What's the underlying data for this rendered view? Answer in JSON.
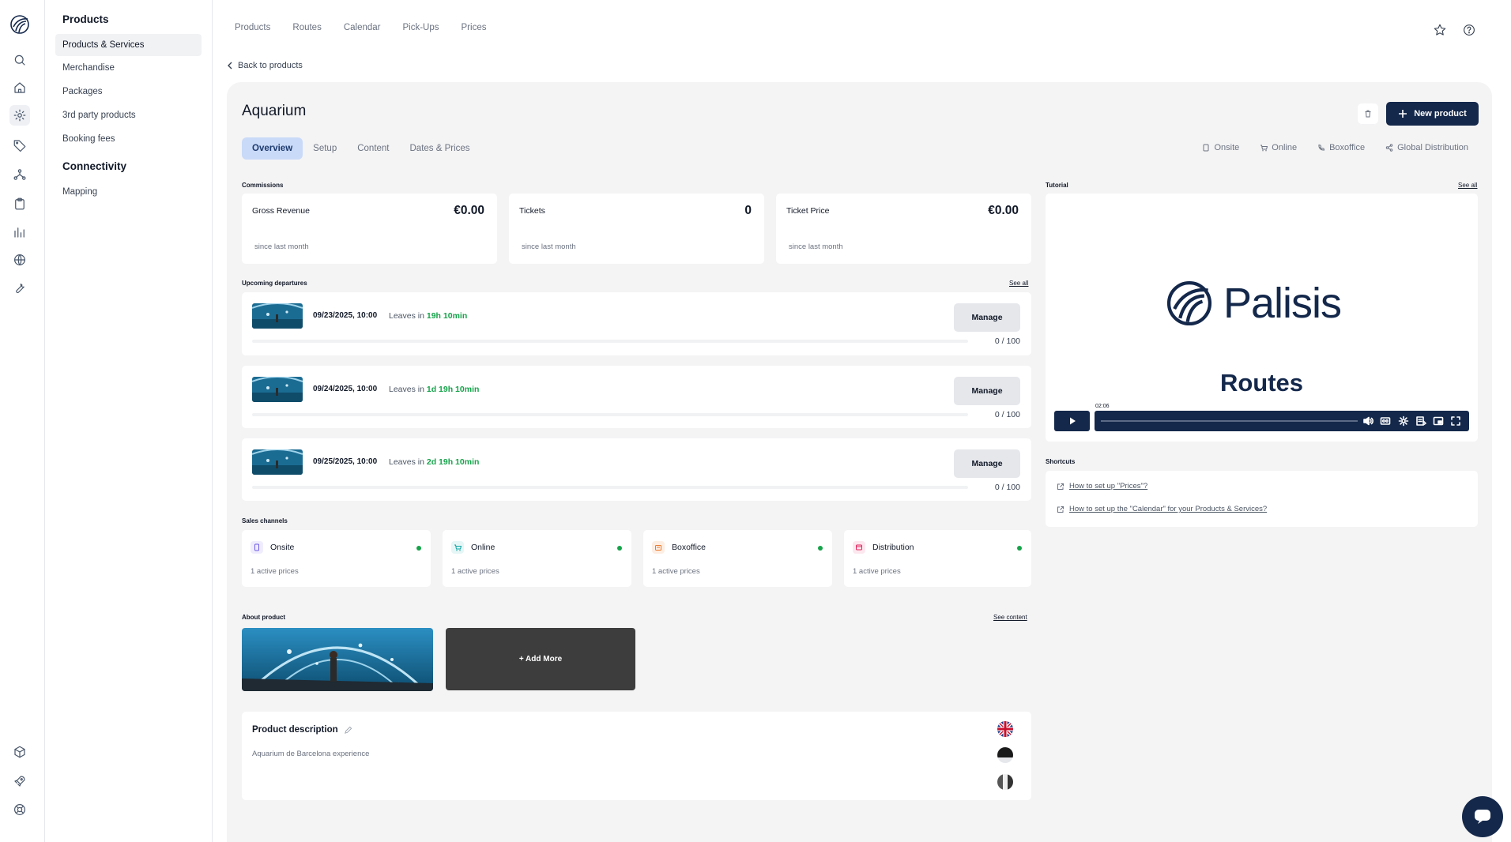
{
  "sidebar": {
    "group1_title": "Products",
    "items1": [
      "Products & Services",
      "Merchandise",
      "Packages",
      "3rd party products",
      "Booking fees"
    ],
    "group2_title": "Connectivity",
    "items2": [
      "Mapping"
    ]
  },
  "topnav": [
    "Products",
    "Routes",
    "Calendar",
    "Pick-Ups",
    "Prices"
  ],
  "back_label": "Back to products",
  "product": {
    "title": "Aquarium",
    "new_button": "New product",
    "tabs": [
      "Overview",
      "Setup",
      "Content",
      "Dates & Prices"
    ],
    "channels_top": [
      "Onsite",
      "Online",
      "Boxoffice",
      "Global Distribution"
    ]
  },
  "commissions": {
    "label": "Commissions",
    "cards": [
      {
        "label": "Gross Revenue",
        "value": "€0.00",
        "sub": "since last month"
      },
      {
        "label": "Tickets",
        "value": "0",
        "sub": "since last month"
      },
      {
        "label": "Ticket Price",
        "value": "€0.00",
        "sub": "since last month"
      }
    ]
  },
  "departures": {
    "label": "Upcoming departures",
    "see_all": "See all",
    "items": [
      {
        "date": "09/23/2025, 10:00",
        "leaves_prefix": "Leaves in",
        "leaves_in": "19h 10min",
        "button": "Manage",
        "count": "0 / 100",
        "progress": 0
      },
      {
        "date": "09/24/2025, 10:00",
        "leaves_prefix": "Leaves in",
        "leaves_in": "1d 19h 10min",
        "button": "Manage",
        "count": "0 / 100",
        "progress": 0
      },
      {
        "date": "09/25/2025, 10:00",
        "leaves_prefix": "Leaves in",
        "leaves_in": "2d 19h 10min",
        "button": "Manage",
        "count": "0 / 100",
        "progress": 0
      }
    ]
  },
  "sales_channels": {
    "label": "Sales channels",
    "items": [
      {
        "name": "Onsite",
        "sub": "1 active prices",
        "icon_color": "#6d5ae6",
        "icon_bg": "#efedfd"
      },
      {
        "name": "Online",
        "sub": "1 active prices",
        "icon_color": "#0ea5a4",
        "icon_bg": "#e6f6f6"
      },
      {
        "name": "Boxoffice",
        "sub": "1 active prices",
        "icon_color": "#ea7b2c",
        "icon_bg": "#fdeee3"
      },
      {
        "name": "Distribution",
        "sub": "1 active prices",
        "icon_color": "#e0245e",
        "icon_bg": "#fde7ee"
      }
    ],
    "status_color": "#16a34a"
  },
  "about": {
    "label": "About product",
    "see_content": "See content",
    "add_more": "+ Add More"
  },
  "description": {
    "title": "Product description",
    "text": "Aquarium de Barcelona experience"
  },
  "tutorial": {
    "label": "Tutorial",
    "see_all": "See all",
    "video_logo": "Palisis",
    "video_title": "Routes",
    "time": "02:06",
    "progress": 0.02
  },
  "shortcuts": {
    "label": "Shortcuts",
    "items": [
      "How to set up \"Prices\"?",
      "How to set up the \"Calendar\" for your Products & Services?"
    ]
  },
  "colors": {
    "brand": "#14284b",
    "active_tab": "#c9daf8",
    "panel_bg": "#f4f4f5",
    "green": "#16a34a"
  }
}
